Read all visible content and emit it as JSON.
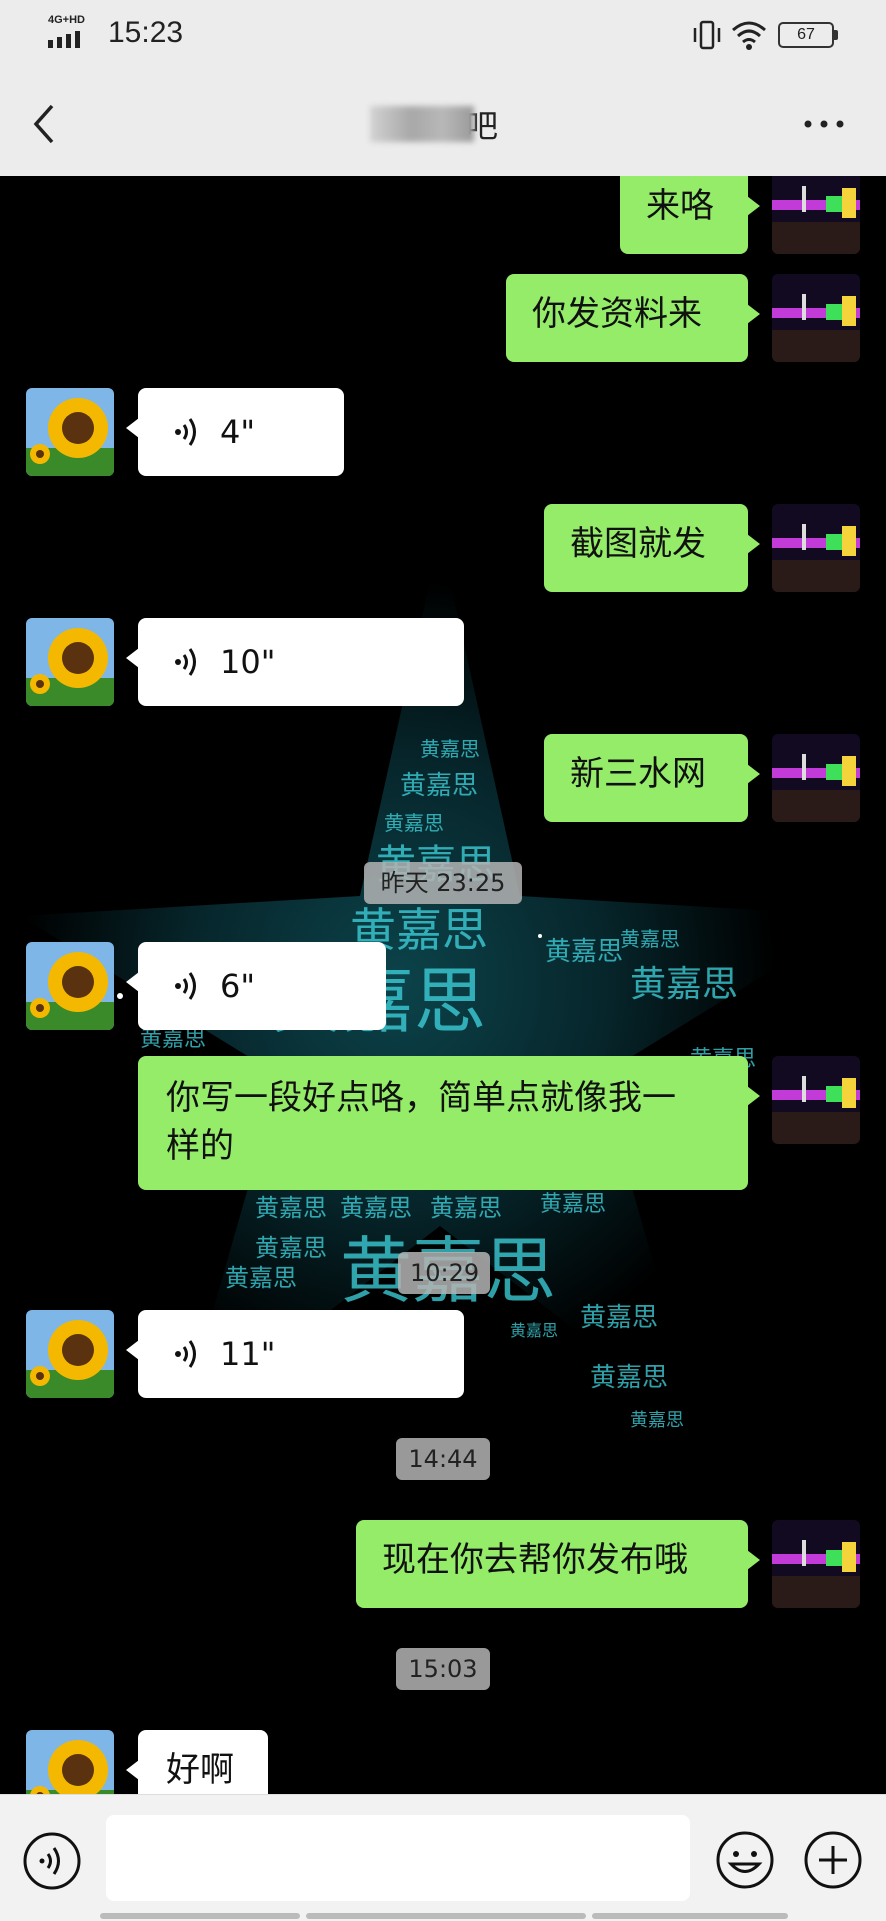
{
  "status_bar": {
    "network": "4G+HD",
    "time": "15:23",
    "battery": "67"
  },
  "nav": {
    "title_visible_part": "吧"
  },
  "background_watermark_text": "黄嘉思",
  "messages": [
    {
      "side": "me",
      "type": "text",
      "text": "来咯"
    },
    {
      "side": "me",
      "type": "text",
      "text": "你发资料来"
    },
    {
      "side": "other",
      "type": "voice",
      "duration": "4\""
    },
    {
      "side": "me",
      "type": "text",
      "text": "截图就发"
    },
    {
      "side": "other",
      "type": "voice",
      "duration": "10\""
    },
    {
      "side": "me",
      "type": "text",
      "text": "新三水网"
    },
    {
      "type": "timestamp",
      "text": "昨天 23:25"
    },
    {
      "side": "other",
      "type": "voice",
      "duration": "6\""
    },
    {
      "side": "me",
      "type": "text",
      "text": "你写一段好点咯，简单点就像我一样的",
      "line1": "你写一段好点咯，简单点就像我一",
      "line2": "样的"
    },
    {
      "type": "timestamp",
      "text": "10:29"
    },
    {
      "side": "other",
      "type": "voice",
      "duration": "11\""
    },
    {
      "type": "timestamp",
      "text": "14:44"
    },
    {
      "side": "me",
      "type": "text",
      "text": "现在你去帮你发布哦"
    },
    {
      "type": "timestamp",
      "text": "15:03"
    },
    {
      "side": "other",
      "type": "text",
      "text": "好啊"
    }
  ],
  "icons": {
    "back": "chevron-left-icon",
    "more": "more-dots-icon",
    "voice_input": "voice-input-icon",
    "emoji": "emoji-icon",
    "plus": "plus-icon",
    "voice_message": "voice-wave-icon"
  },
  "colors": {
    "my_bubble": "#95ec69",
    "other_bubble": "#ffffff",
    "chat_bg": "#000000",
    "bar_bg": "#ececec"
  }
}
